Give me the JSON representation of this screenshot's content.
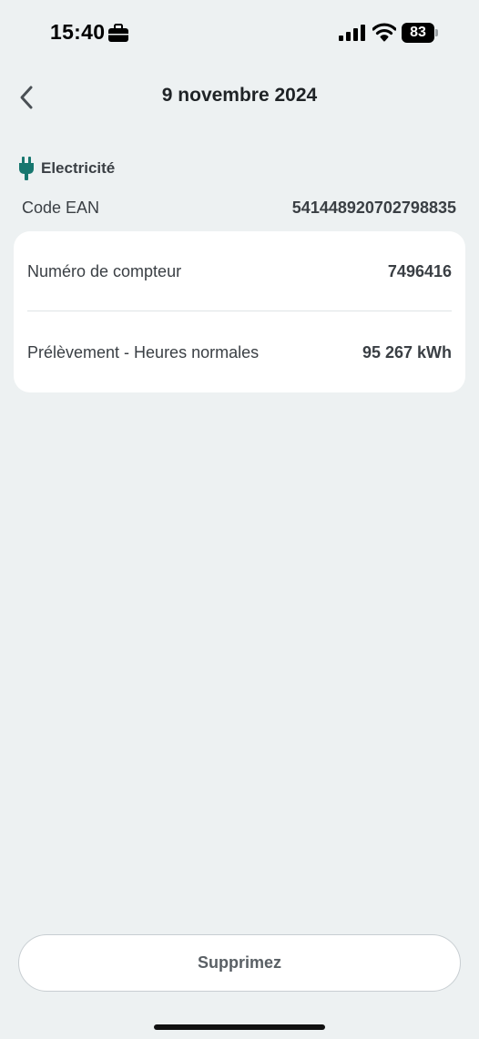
{
  "status_bar": {
    "time": "15:40",
    "battery_level": "83",
    "icons": [
      "briefcase-icon",
      "signal-icon",
      "wifi-icon",
      "battery-icon"
    ]
  },
  "header": {
    "title": "9 novembre 2024",
    "back_icon": "chevron-left-icon"
  },
  "energy": {
    "type_label": "Electricité",
    "icon": "plug-icon",
    "accent_color": "#17776f"
  },
  "ean": {
    "label": "Code EAN",
    "value": "541448920702798835"
  },
  "card": {
    "rows": [
      {
        "label": "Numéro de compteur",
        "value": "7496416"
      },
      {
        "label": "Prélèvement - Heures normales",
        "value": "95 267 kWh"
      }
    ]
  },
  "actions": {
    "delete_label": "Supprimez"
  }
}
